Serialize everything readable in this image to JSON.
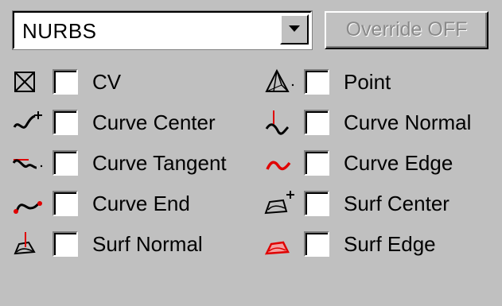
{
  "dropdown": {
    "selected": "NURBS"
  },
  "override_button": {
    "label": "Override OFF"
  },
  "colors": {
    "background": "#c0c0c0",
    "icon_red": "#e00000",
    "icon_black": "#000000"
  },
  "options_left": [
    {
      "label": "CV",
      "icon": "cv-box-x-icon",
      "checked": false
    },
    {
      "label": "Curve Center",
      "icon": "curve-center-icon",
      "checked": false
    },
    {
      "label": "Curve Tangent",
      "icon": "curve-tangent-icon",
      "checked": false
    },
    {
      "label": "Curve End",
      "icon": "curve-end-icon",
      "checked": false
    },
    {
      "label": "Surf Normal",
      "icon": "surf-normal-icon",
      "checked": false
    }
  ],
  "options_right": [
    {
      "label": "Point",
      "icon": "point-pyramid-icon",
      "checked": false
    },
    {
      "label": "Curve Normal",
      "icon": "curve-normal-icon",
      "checked": false
    },
    {
      "label": "Curve Edge",
      "icon": "curve-edge-icon",
      "checked": false
    },
    {
      "label": "Surf Center",
      "icon": "surf-center-icon",
      "checked": false
    },
    {
      "label": "Surf Edge",
      "icon": "surf-edge-icon",
      "checked": false
    }
  ]
}
